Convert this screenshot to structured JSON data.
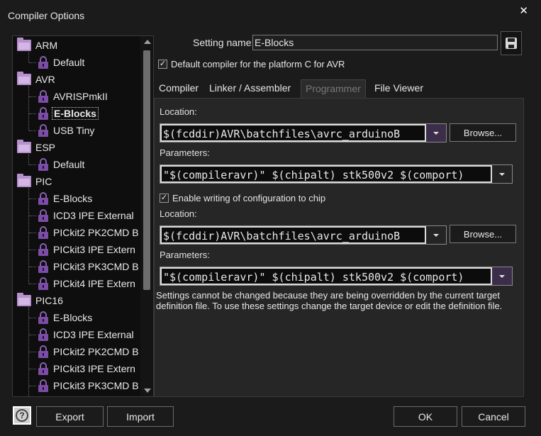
{
  "window": {
    "title": "Compiler Options",
    "close_label": "✕"
  },
  "tree": {
    "nodes": [
      {
        "label": "ARM",
        "kind": "folder",
        "level": 0
      },
      {
        "label": "Default",
        "kind": "lock",
        "level": 1
      },
      {
        "label": "AVR",
        "kind": "folder",
        "level": 0
      },
      {
        "label": "AVRISPmkII",
        "kind": "lock",
        "level": 1
      },
      {
        "label": "E-Blocks",
        "kind": "lock",
        "level": 1,
        "selected": true
      },
      {
        "label": "USB Tiny",
        "kind": "lock",
        "level": 1
      },
      {
        "label": "ESP",
        "kind": "folder",
        "level": 0
      },
      {
        "label": "Default",
        "kind": "lock",
        "level": 1
      },
      {
        "label": "PIC",
        "kind": "folder",
        "level": 0
      },
      {
        "label": "E-Blocks",
        "kind": "lock",
        "level": 1
      },
      {
        "label": "ICD3 IPE External",
        "kind": "lock",
        "level": 1
      },
      {
        "label": "PICkit2 PK2CMD B",
        "kind": "lock",
        "level": 1
      },
      {
        "label": "PICkit3 IPE Extern",
        "kind": "lock",
        "level": 1
      },
      {
        "label": "PICkit3 PK3CMD B",
        "kind": "lock",
        "level": 1
      },
      {
        "label": "PICkit4 IPE Extern",
        "kind": "lock",
        "level": 1
      },
      {
        "label": "PIC16",
        "kind": "folder",
        "level": 0
      },
      {
        "label": "E-Blocks",
        "kind": "lock",
        "level": 1
      },
      {
        "label": "ICD3 IPE External",
        "kind": "lock",
        "level": 1
      },
      {
        "label": "PICkit2 PK2CMD B",
        "kind": "lock",
        "level": 1
      },
      {
        "label": "PICkit3 IPE Extern",
        "kind": "lock",
        "level": 1
      },
      {
        "label": "PICkit3 PK3CMD B",
        "kind": "lock",
        "level": 1
      }
    ]
  },
  "setting": {
    "label": "Setting name:",
    "value": "E-Blocks"
  },
  "default_compiler": {
    "label": "Default compiler for the platform C for AVR",
    "checked": "✓"
  },
  "tabs": [
    {
      "label": "Compiler"
    },
    {
      "label": "Linker / Assembler"
    },
    {
      "label": "Programmer",
      "active": true
    },
    {
      "label": "File Viewer"
    }
  ],
  "programmer": {
    "location_label": "Location:",
    "location_value": "$(fcddir)AVR\\batchfiles\\avrc_arduinoB",
    "params_label": "Parameters:",
    "params_value": "\"$(compileravr)\" $(chipalt) stk500v2 $(comport)",
    "config_check_label": "Enable writing of configuration to chip",
    "config_checked": "✓",
    "location2_label": "Location:",
    "location2_value": "$(fcddir)AVR\\batchfiles\\avrc_arduinoB",
    "params2_label": "Parameters:",
    "params2_value": "\"$(compileravr)\" $(chipalt) stk500v2 $(comport)",
    "browse_label": "Browse...",
    "notice": "Settings cannot be changed because they are being overridden by the current target definition file. To use these settings change the target device or edit the definition file."
  },
  "buttons": {
    "help": "?",
    "export": "Export",
    "import": "Import",
    "ok": "OK",
    "cancel": "Cancel"
  }
}
